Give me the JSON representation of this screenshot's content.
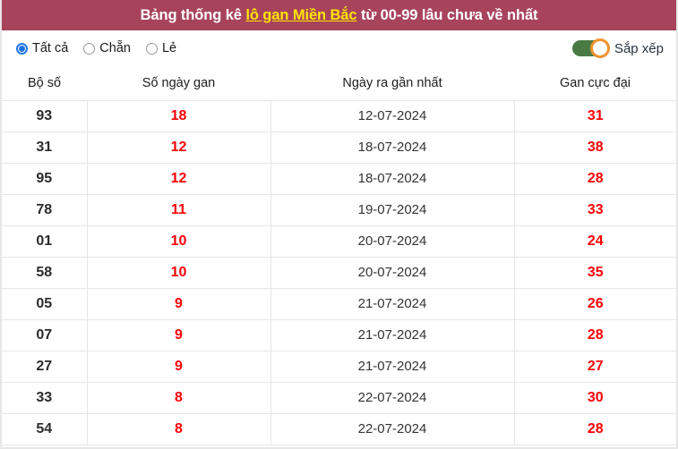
{
  "header": {
    "title_prefix": "Bảng thống kê ",
    "title_link": "lô gan Miền Bắc",
    "title_suffix": " từ 00-99 lâu chưa về nhất",
    "bg_color": "#a8435c",
    "link_color": "#ffe600"
  },
  "filters": {
    "radios": [
      {
        "label": "Tất cả",
        "selected": true
      },
      {
        "label": "Chẵn",
        "selected": false
      },
      {
        "label": "Lẻ",
        "selected": false
      }
    ],
    "sort": {
      "label": "Sắp xếp",
      "enabled": true,
      "track_color": "#4a7a44",
      "knob_color": "#f0922b"
    }
  },
  "table": {
    "columns": [
      "Bộ số",
      "Số ngày gan",
      "Ngày ra gần nhất",
      "Gan cực đại"
    ],
    "accent_color": "#fb0006",
    "rows": [
      {
        "bo_so": "93",
        "so_ngay_gan": "18",
        "ngay_ra_gan_nhat": "12-07-2024",
        "gan_cuc_dai": "31"
      },
      {
        "bo_so": "31",
        "so_ngay_gan": "12",
        "ngay_ra_gan_nhat": "18-07-2024",
        "gan_cuc_dai": "38"
      },
      {
        "bo_so": "95",
        "so_ngay_gan": "12",
        "ngay_ra_gan_nhat": "18-07-2024",
        "gan_cuc_dai": "28"
      },
      {
        "bo_so": "78",
        "so_ngay_gan": "11",
        "ngay_ra_gan_nhat": "19-07-2024",
        "gan_cuc_dai": "33"
      },
      {
        "bo_so": "01",
        "so_ngay_gan": "10",
        "ngay_ra_gan_nhat": "20-07-2024",
        "gan_cuc_dai": "24"
      },
      {
        "bo_so": "58",
        "so_ngay_gan": "10",
        "ngay_ra_gan_nhat": "20-07-2024",
        "gan_cuc_dai": "35"
      },
      {
        "bo_so": "05",
        "so_ngay_gan": "9",
        "ngay_ra_gan_nhat": "21-07-2024",
        "gan_cuc_dai": "26"
      },
      {
        "bo_so": "07",
        "so_ngay_gan": "9",
        "ngay_ra_gan_nhat": "21-07-2024",
        "gan_cuc_dai": "28"
      },
      {
        "bo_so": "27",
        "so_ngay_gan": "9",
        "ngay_ra_gan_nhat": "21-07-2024",
        "gan_cuc_dai": "27"
      },
      {
        "bo_so": "33",
        "so_ngay_gan": "8",
        "ngay_ra_gan_nhat": "22-07-2024",
        "gan_cuc_dai": "30"
      },
      {
        "bo_so": "54",
        "so_ngay_gan": "8",
        "ngay_ra_gan_nhat": "22-07-2024",
        "gan_cuc_dai": "28"
      }
    ]
  }
}
